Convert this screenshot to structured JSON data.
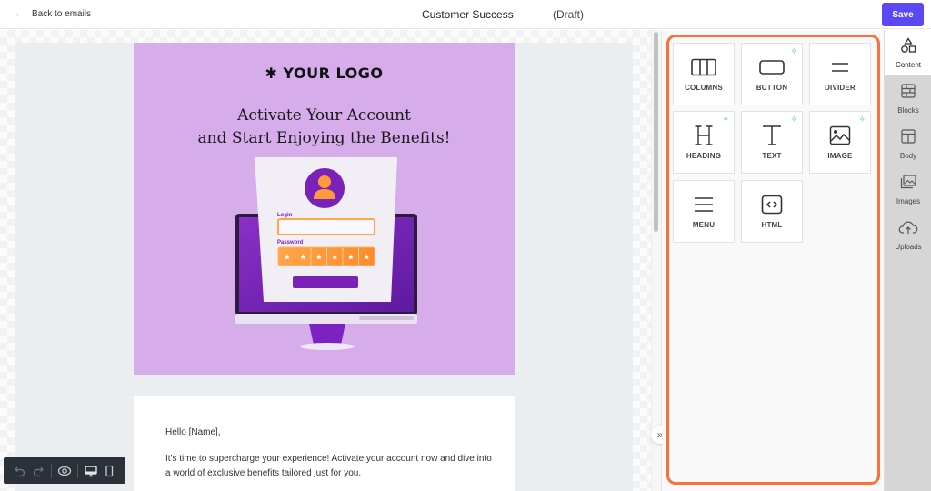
{
  "header": {
    "back_label": "Back to emails",
    "title": "Customer Success",
    "status": "(Draft)",
    "save_label": "Save",
    "accent_color": "#5a48f5"
  },
  "email": {
    "logo_text": "✱ YOUR LOGO",
    "headline_line1": "Activate Your Account",
    "headline_line2": "and Start Enjoying the Benefits!",
    "illustration": {
      "login_label": "Login",
      "password_label": "Password",
      "password_mask": [
        "★",
        "★",
        "★",
        "★",
        "★",
        "★"
      ]
    },
    "greeting": "Hello [Name],",
    "paragraph": "It's time to supercharge your experience! Activate your account now and dive into a world of exclusive benefits tailored just for you.",
    "hero_bg_color": "#d6aceb"
  },
  "canvas_toolbar": {
    "undo": "undo-icon",
    "redo": "redo-icon",
    "preview": "eye-icon",
    "desktop": "desktop-icon",
    "mobile": "mobile-icon"
  },
  "content_panel": {
    "highlight_color": "#ff6f3c",
    "tiles": [
      {
        "label": "COLUMNS",
        "icon": "columns-icon",
        "ai": false
      },
      {
        "label": "BUTTON",
        "icon": "button-icon",
        "ai": true
      },
      {
        "label": "DIVIDER",
        "icon": "divider-icon",
        "ai": false
      },
      {
        "label": "HEADING",
        "icon": "heading-icon",
        "ai": true
      },
      {
        "label": "TEXT",
        "icon": "text-icon",
        "ai": true
      },
      {
        "label": "IMAGE",
        "icon": "image-icon",
        "ai": true
      },
      {
        "label": "MENU",
        "icon": "menu-icon",
        "ai": false
      },
      {
        "label": "HTML",
        "icon": "html-icon",
        "ai": false
      }
    ],
    "ai_glyph": "✧"
  },
  "rail": {
    "items": [
      {
        "label": "Content",
        "icon": "shapes-icon",
        "active": true
      },
      {
        "label": "Blocks",
        "icon": "blocks-icon",
        "active": false
      },
      {
        "label": "Body",
        "icon": "body-icon",
        "active": false
      },
      {
        "label": "Images",
        "icon": "images-icon",
        "active": false
      },
      {
        "label": "Uploads",
        "icon": "upload-cloud-icon",
        "active": false
      }
    ]
  },
  "collapse_glyph": "»"
}
